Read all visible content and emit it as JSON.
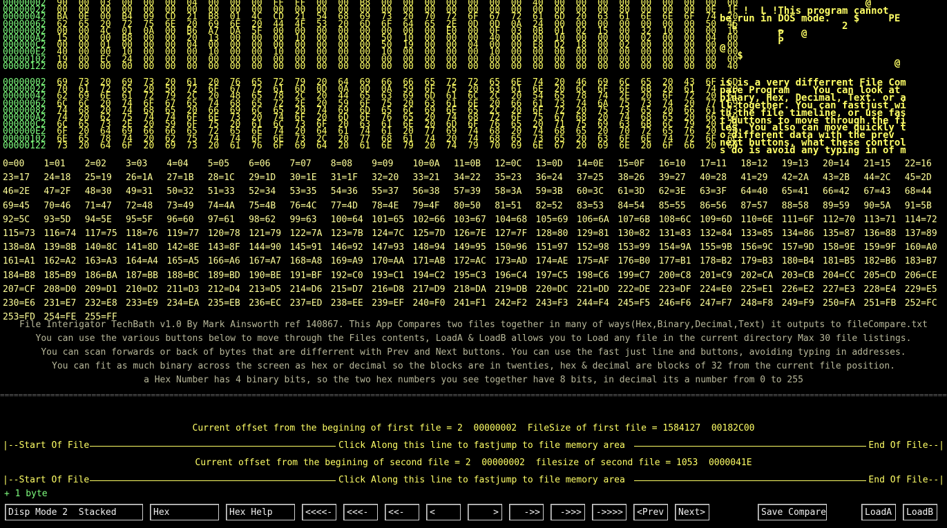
{
  "file1": {
    "offsets": [
      "00000002",
      "00000022",
      "00000042",
      "00000062",
      "00000082",
      "000000A2",
      "000000C2",
      "000000E2",
      "00000102",
      "00000122"
    ],
    "bytes": [
      "90  00  03  00  00  00  04  00  00  00  FF  FF  00  00  B8  00  00  00  00  00  00  00  40  00  00  00  00  00  00  00  00  00",
      "00  00  00  00  00  00  00  00  00  00  00  00  00  00  00  00  00  00  00  00  00  00  00  00  00  00  80  00  00  00  0E  1F",
      "BA  0E  00  B4  09  CD  21  B8  01  4C  CD  21  54  68  69  73  20  70  72  6F  67  72  61  6D  20  63  61  6E  6E  6F  74  20",
      "62  65  20  72  75  6E  20  69  6E  20  44  4F  53  20  6D  6F  64  65  2E  0D  0D  0A  24  00  00  00  00  00  00  00  50  45",
      "00  00  4C  01  0A  00  B6  A7  DA  5F  00  00  00  00  00  00  00  00  E0  00  0F  03  0B  01  02  15  00  32  10  00  00  16",
      "15  00  00  B8  00  00  20  13  00  00  00  10  00  00  00  50  10  00  00  00  40  00  00  10  00  00  00  02  00  00  04  00",
      "00  00  01  00  00  00  04  00  00  00  00  00  00  00  00  50  19  00  00  04  00  00  E8  D2  18  00  02  00  00  00  00  00",
      "40  00  00  10  00  00  00  10  00  00  10  00  00  00  00  10  00  00  00  00  10  00  00  00  00  00  00  00  00  00  00  00",
      "19  00  EC  24  00  00  00  00  00  00  00  00  00  00  00  00  00  00  00  00  00  00  00  00  00  00  00  00  00  00  00  00",
      "00  00  00  00  00  00  00  00  00  00  00  00  00  00  00  00  00  00  00  00  00  00  00  00  00  00  00  00  00  00  00  40"
    ],
    "ascii": [
      "                         @",
      "",
      "    !  L !This program cannot",
      "be run in DOS mode.    $     PE",
      "  L       _          2",
      "          P   @",
      "          P",
      "@",
      "   $",
      "                              @"
    ]
  },
  "file2": {
    "offsets": [
      "00000002",
      "00000022",
      "00000042",
      "00000062",
      "00000082",
      "000000A2",
      "000000C2",
      "000000E2",
      "00000102",
      "00000122"
    ],
    "bytes": [
      "69  73  20  69  73  20  61  20  76  65  72  79  20  64  69  66  66  65  72  72  65  6E  74  20  46  69  6C  65  20  43  6F  6D",
      "70  61  72  65  20  50  72  6F  67  72  61  6D  0D  0A  0D  0A  59  6F  75  20  63  61  6E  20  6C  6F  6F  6B  20  61  74  20",
      "62  69  6E  61  72  79  2C  20  48  65  78  2C  20  44  65  63  69  6D  61  6C  2C  20  54  65  78  74  2E  20  6F  72  20  61",
      "6C  6C  20  74  6F  67  65  74  68  65  72  2E  20  59  6F  75  20  63  61  6E  20  66  61  73  74  6A  75  73  74  20  77  69",
      "74  68  20  74  68  65  20  66  69  6C  65  20  74  69  6D  65  6C  69  6E  65  2C  20  6F  72  20  75  73  65  20  66  61  73",
      "74  20  62  75  74  74  6F  6E  73  20  74  6F  20  6D  6F  76  65  20  74  68  72  6F  75  67  68  20  74  68  65  20  66  69",
      "6C  65  73  2E  20  59  6F  75  20  61  6C  73  6F  20  63  61  6E  20  6D  6F  76  65  20  71  75  69  63  6B  6C  79  20  74",
      "6F  20  64  69  66  66  65  72  65  6E  74  20  64  61  74  61  20  77  69  74  68  20  74  68  65  20  70  72  65  76  20  20",
      "6E  65  78  74  20  62  75  74  74  6F  6E  73  2C  20  77  68  61  74  20  74  68  65  73  65  20  63  6F  6E  74  72  6F  6C",
      "73  20  64  6F  20  69  73  20  61  76  6F  69  64  20  61  6E  79  20  74  79  70  69  6E  67  20  69  6E  20  6F  66  20  6D"
    ],
    "ascii": [
      "is is a very differrent File Com",
      "pare Program    You can look at",
      "binary, Hex, Decimal, Text. or a",
      "ll together. You can fastjust wi",
      "th the file timeline, or use fas",
      "t buttons to move through the fi",
      "les. You also can move quickly t",
      "o different data with the prev",
      "next buttons, what these control",
      "s do is avoid any typing in of m"
    ]
  },
  "conversions": [
    "0=00",
    "1=01",
    "2=02",
    "3=03",
    "4=04",
    "5=05",
    "6=06",
    "7=07",
    "8=08",
    "9=09",
    "10=0A",
    "11=0B",
    "12=0C",
    "13=0D",
    "14=0E",
    "15=0F",
    "16=10",
    "17=11",
    "18=12",
    "19=13",
    "20=14",
    "21=15",
    "22=16",
    "23=17",
    "24=18",
    "25=19",
    "26=1A",
    "27=1B",
    "28=1C",
    "29=1D",
    "30=1E",
    "31=1F",
    "32=20",
    "33=21",
    "34=22",
    "35=23",
    "36=24",
    "37=25",
    "38=26",
    "39=27",
    "40=28",
    "41=29",
    "42=2A",
    "43=2B",
    "44=2C",
    "45=2D",
    "46=2E",
    "47=2F",
    "48=30",
    "49=31",
    "50=32",
    "51=33",
    "52=34",
    "53=35",
    "54=36",
    "55=37",
    "56=38",
    "57=39",
    "58=3A",
    "59=3B",
    "60=3C",
    "61=3D",
    "62=3E",
    "63=3F",
    "64=40",
    "65=41",
    "66=42",
    "67=43",
    "68=44",
    "69=45",
    "70=46",
    "71=47",
    "72=48",
    "73=49",
    "74=4A",
    "75=4B",
    "76=4C",
    "77=4D",
    "78=4E",
    "79=4F",
    "80=50",
    "81=51",
    "82=52",
    "83=53",
    "84=54",
    "85=55",
    "86=56",
    "87=57",
    "88=58",
    "89=59",
    "90=5A",
    "91=5B",
    "92=5C",
    "93=5D",
    "94=5E",
    "95=5F",
    "96=60",
    "97=61",
    "98=62",
    "99=63",
    "100=64",
    "101=65",
    "102=66",
    "103=67",
    "104=68",
    "105=69",
    "106=6A",
    "107=6B",
    "108=6C",
    "109=6D",
    "110=6E",
    "111=6F",
    "112=70",
    "113=71",
    "114=72",
    "115=73",
    "116=74",
    "117=75",
    "118=76",
    "119=77",
    "120=78",
    "121=79",
    "122=7A",
    "123=7B",
    "124=7C",
    "125=7D",
    "126=7E",
    "127=7F",
    "128=80",
    "129=81",
    "130=82",
    "131=83",
    "132=84",
    "133=85",
    "134=86",
    "135=87",
    "136=88",
    "137=89",
    "138=8A",
    "139=8B",
    "140=8C",
    "141=8D",
    "142=8E",
    "143=8F",
    "144=90",
    "145=91",
    "146=92",
    "147=93",
    "148=94",
    "149=95",
    "150=96",
    "151=97",
    "152=98",
    "153=99",
    "154=9A",
    "155=9B",
    "156=9C",
    "157=9D",
    "158=9E",
    "159=9F",
    "160=A0",
    "161=A1",
    "162=A2",
    "163=A3",
    "164=A4",
    "165=A5",
    "166=A6",
    "167=A7",
    "168=A8",
    "169=A9",
    "170=AA",
    "171=AB",
    "172=AC",
    "173=AD",
    "174=AE",
    "175=AF",
    "176=B0",
    "177=B1",
    "178=B2",
    "179=B3",
    "180=B4",
    "181=B5",
    "182=B6",
    "183=B7",
    "184=B8",
    "185=B9",
    "186=BA",
    "187=BB",
    "188=BC",
    "189=BD",
    "190=BE",
    "191=BF",
    "192=C0",
    "193=C1",
    "194=C2",
    "195=C3",
    "196=C4",
    "197=C5",
    "198=C6",
    "199=C7",
    "200=C8",
    "201=C9",
    "202=CA",
    "203=CB",
    "204=CC",
    "205=CD",
    "206=CE",
    "207=CF",
    "208=D0",
    "209=D1",
    "210=D2",
    "211=D3",
    "212=D4",
    "213=D5",
    "214=D6",
    "215=D7",
    "216=D8",
    "217=D9",
    "218=DA",
    "219=DB",
    "220=DC",
    "221=DD",
    "222=DE",
    "223=DF",
    "224=E0",
    "225=E1",
    "226=E2",
    "227=E3",
    "228=E4",
    "229=E5",
    "230=E6",
    "231=E7",
    "232=E8",
    "233=E9",
    "234=EA",
    "235=EB",
    "236=EC",
    "237=ED",
    "238=EE",
    "239=EF",
    "240=F0",
    "241=F1",
    "242=F2",
    "243=F3",
    "244=F4",
    "245=F5",
    "246=F6",
    "247=F7",
    "248=F8",
    "249=F9",
    "250=FA",
    "251=FB",
    "252=FC",
    "253=FD",
    "254=FE",
    "255=FF"
  ],
  "info": {
    "line1": "File Interigator TechBath v1.0 By Mark Ainsworth ref 140867. This App Compares two files together in many of ways(Hex,Binary,Decimal,Text) it outputs to fileCompare.txt",
    "line2": "You can use the various buttons below to move through the Files contents, LoadA & LoadB allows you to Load any file in the current directory Max 30 file listings.",
    "line3": "You can scan forwards or back of bytes that are differrent with Prev and Next buttons. You can use the fast just line and buttons, avoiding typing in addresses.",
    "line4": "You can fit as much binary across the screen as hex or decimal so the blocks are in twenties, hex & decimal are blocks of 32 from the current file position.",
    "line5": "a Hex Number has 4 binary bits, so the two hex numbers you see together have 8 bits, in decimal its a number from 0 to 255"
  },
  "status": {
    "first_offset": "Current offset from the begining of first file = 2  00000002  FileSize of first file = 1584127  00182C00",
    "second_offset": "Current offset from the begining of second file = 2  00000002  filesize of second file = 1053  0000041E",
    "jump_start": "|--Start Of File",
    "jump_middle": "Click Along this line to fastjump to file memory area",
    "jump_end": "End Of File--|",
    "step": "+ 1 byte"
  },
  "buttons": {
    "disp_mode": "Disp Mode 2  Stacked",
    "hex": "Hex",
    "hex_help": "Hex Help",
    "back4": "<<<<-",
    "back3": "<<<-",
    "back2": "<<-",
    "back1": "<",
    "fwd1": ">",
    "fwd2": "->>",
    "fwd3": "->>>",
    "fwd4": "->>>>",
    "prev": "<Prev",
    "next": "Next>",
    "save": "Save Compare",
    "loada": "LoadA",
    "loadb": "LoadB"
  }
}
